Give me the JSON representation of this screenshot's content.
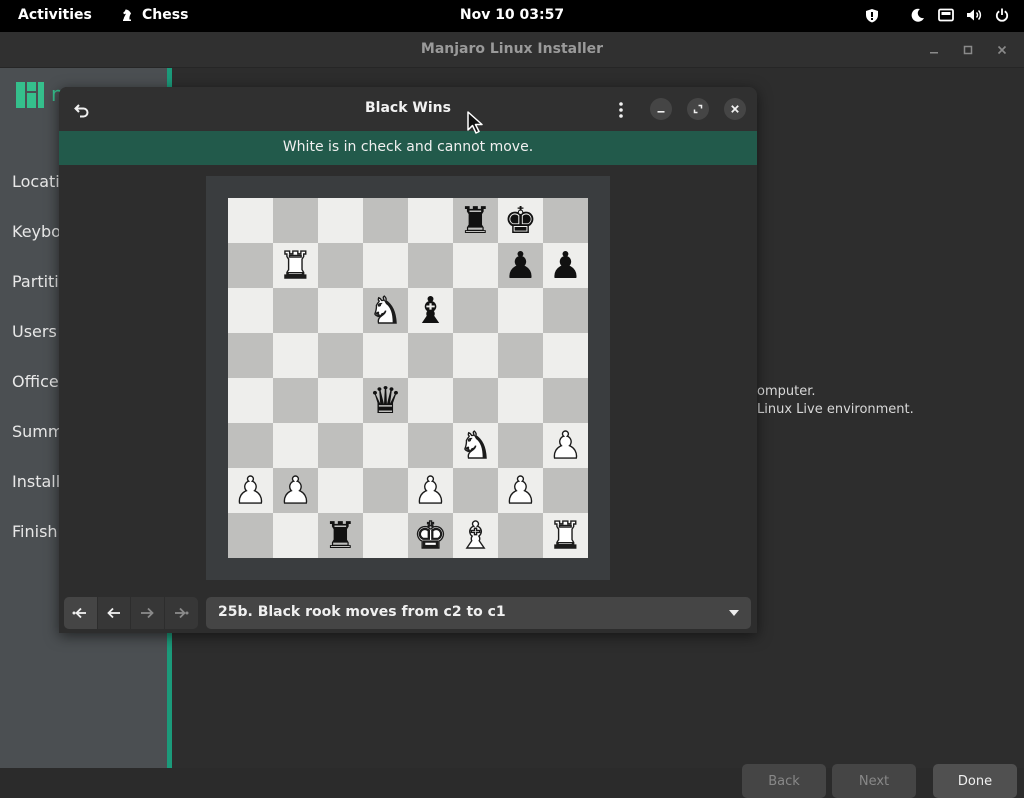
{
  "topbar": {
    "activities": "Activities",
    "app_name": "Chess",
    "clock": "Nov 10  03:57",
    "tray_icons": [
      "shield-icon",
      "night-mode-icon",
      "screen-icon",
      "volume-icon",
      "power-icon"
    ]
  },
  "installer": {
    "title": "Manjaro Linux Installer",
    "logo_letter": "n",
    "sidebar": [
      "Locati",
      "Keybo",
      "Partiti",
      "Users",
      "Office",
      "Summ",
      "Install",
      "Finish"
    ],
    "main_text": [
      "omputer.",
      " Linux Live environment."
    ],
    "buttons": {
      "back": "Back",
      "next": "Next",
      "done": "Done"
    },
    "accent_color": "#1b9a7a"
  },
  "chess": {
    "title": "Black Wins",
    "status": "White is in check and cannot move.",
    "move": "25b. Black rook moves from c2 to c1",
    "board": [
      [
        "",
        "",
        "",
        "",
        "",
        "r",
        "k",
        ""
      ],
      [
        "",
        "R",
        "",
        "",
        "",
        "",
        "p",
        "p"
      ],
      [
        "",
        "",
        "",
        "N",
        "b",
        "",
        "",
        ""
      ],
      [
        "",
        "",
        "",
        "",
        "",
        "",
        "",
        ""
      ],
      [
        "",
        "",
        "",
        "q",
        "",
        "",
        "",
        ""
      ],
      [
        "",
        "",
        "",
        "",
        "",
        "N",
        "",
        "P"
      ],
      [
        "P",
        "P",
        "",
        "",
        "P",
        "",
        "P",
        ""
      ],
      [
        "",
        "",
        "r",
        "",
        "K",
        "B",
        "",
        "R"
      ]
    ],
    "banner_color": "#225a4b"
  }
}
